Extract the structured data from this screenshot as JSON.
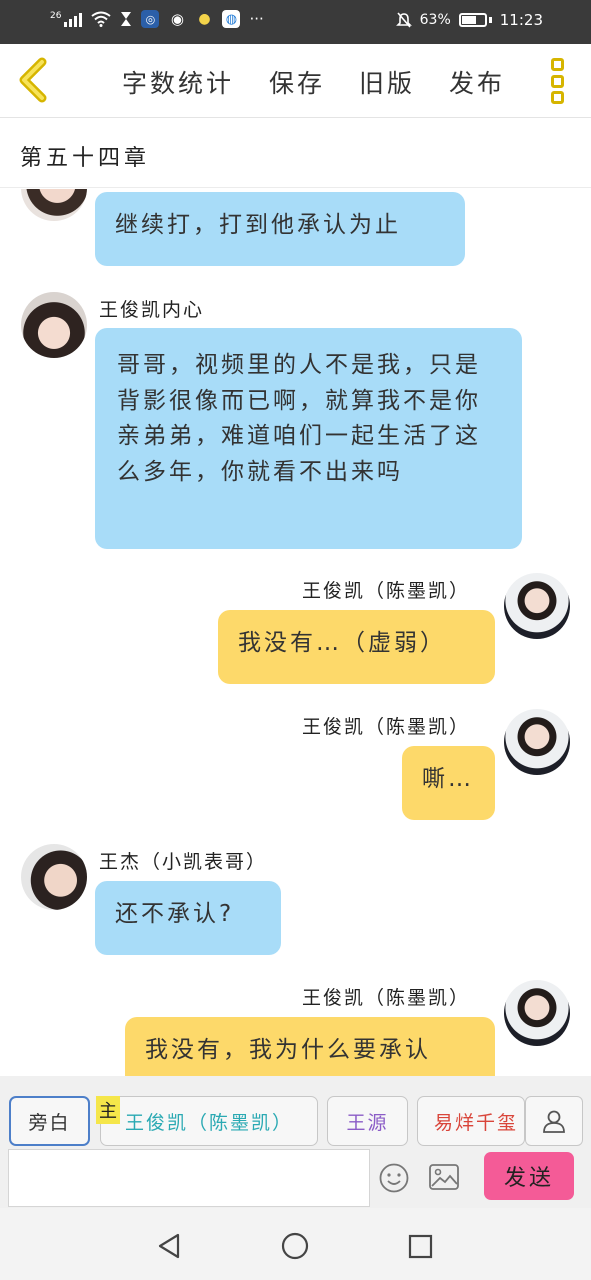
{
  "status_bar": {
    "network": "26",
    "battery_text": "63%",
    "time": "11:23",
    "more": "···"
  },
  "toolbar": {
    "word_count": "字数统计",
    "save": "保存",
    "old_version": "旧版",
    "publish": "发布"
  },
  "chapter_title": "第五十四章",
  "messages": [
    {
      "side": "left",
      "name": "",
      "text": "继续打，打到他承认为止",
      "color": "blue"
    },
    {
      "side": "left",
      "name": "王俊凯内心",
      "text": "哥哥，视频里的人不是我，只是背影很像而已啊，就算我不是你亲弟弟，难道咱们一起生活了这么多年，你就看不出来吗",
      "color": "blue"
    },
    {
      "side": "right",
      "name": "王俊凯（陈墨凯）",
      "text": "我没有…（虚弱）",
      "color": "yellow"
    },
    {
      "side": "right",
      "name": "王俊凯（陈墨凯）",
      "text": "嘶…",
      "color": "yellow"
    },
    {
      "side": "left",
      "name": "王杰（小凯表哥）",
      "text": "还不承认?",
      "color": "blue"
    },
    {
      "side": "right",
      "name": "王俊凯（陈墨凯）",
      "text": "我没有，我为什么要承认",
      "color": "yellow"
    }
  ],
  "roles": {
    "narration": "旁白",
    "main_tag": "主",
    "role1": "王俊凯（陈墨凯）",
    "role2": "王源",
    "role3": "易烊千玺"
  },
  "input": {
    "placeholder": "",
    "send": "发送"
  },
  "colors": {
    "blue_bubble": "#a8dcf8",
    "yellow_bubble": "#fdd96a",
    "send_button": "#f45b97",
    "accent_yellow": "#d6b500",
    "role1_text": "#2aa9b3",
    "role2_text": "#8b5cc7",
    "role3_text": "#d9453a"
  },
  "icons": [
    "back-icon",
    "more-icon",
    "emoji-icon",
    "image-icon",
    "person-icon",
    "nav-back-icon",
    "nav-home-icon",
    "nav-recents-icon"
  ]
}
